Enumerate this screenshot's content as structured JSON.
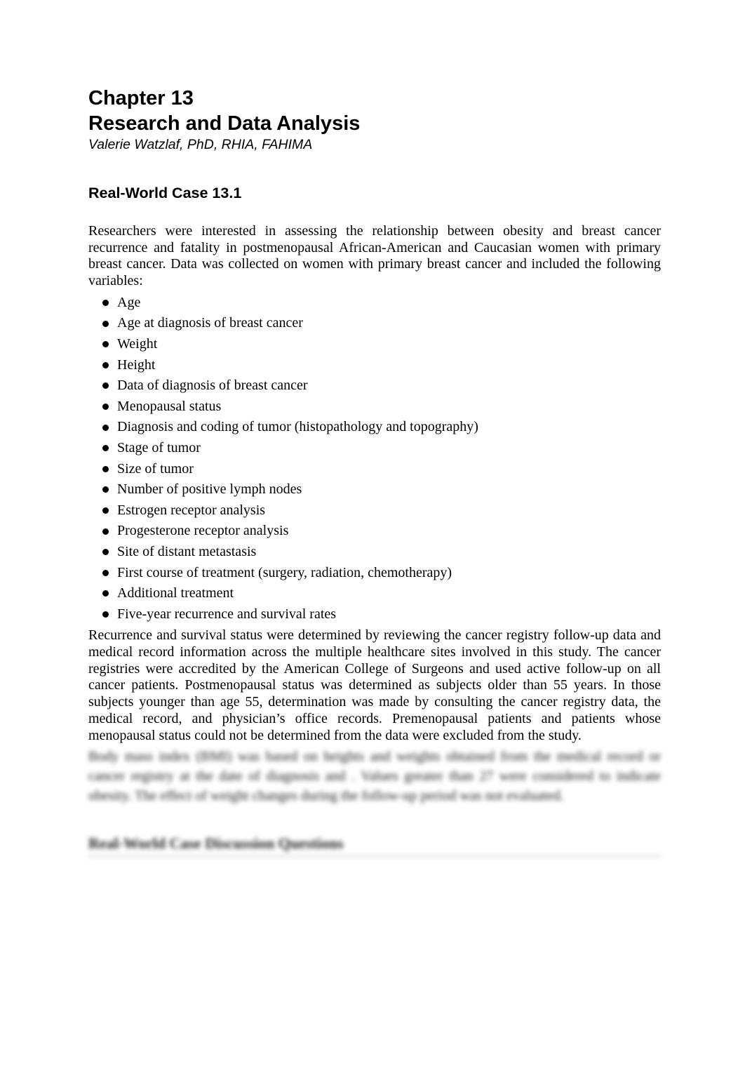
{
  "header": {
    "chapter_label": "Chapter 13",
    "chapter_title": "Research and Data Analysis",
    "author": "Valerie Watzlaf, PhD, RHIA, FAHIMA"
  },
  "case": {
    "title": "Real-World Case 13.1",
    "intro": "Researchers were interested in assessing the relationship between obesity and breast cancer recurrence and fatality in postmenopausal African-American and Caucasian women with primary breast cancer. Data was collected on women with primary breast cancer and included the following variables:",
    "variables": [
      "Age",
      "Age at diagnosis of breast cancer",
      "Weight",
      "Height",
      "Data of diagnosis of breast cancer",
      "Menopausal status",
      "Diagnosis and coding of tumor (histopathology and topography)",
      "Stage of tumor",
      "Size of tumor",
      "Number of positive lymph nodes",
      "Estrogen receptor analysis",
      "Progesterone receptor analysis",
      "Site of distant metastasis",
      "First course of treatment (surgery, radiation, chemotherapy)",
      "Additional treatment",
      "Five-year recurrence and survival rates"
    ],
    "body": "Recurrence and survival status were determined by reviewing the cancer registry follow-up data and medical record information across the multiple healthcare sites involved in this study. The cancer registries were accredited by the American College of Surgeons and used active follow-up on all cancer patients. Postmenopausal status was determined as subjects older than 55 years. In those subjects younger than age 55, determination was made by consulting the cancer registry data, the medical record, and physician’s office records. Premenopausal patients and patients whose menopausal status could not be determined from the data were excluded from the study.",
    "blurred_paragraph": "Body mass index (BMI) was based on heights and weights obtained from the medical record or cancer registry at the date of diagnosis and . Values greater than 27 were considered to indicate obesity. The effect of weight changes during the follow-up period was not evaluated.",
    "blurred_heading": "Real-World Case Discussion Questions"
  }
}
